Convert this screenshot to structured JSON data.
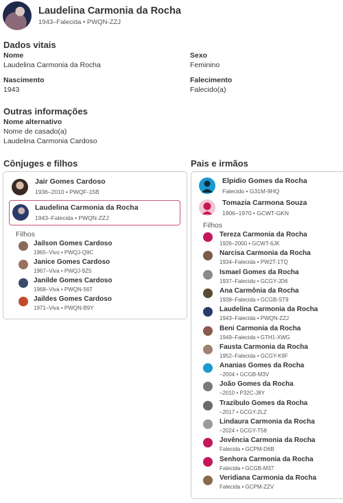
{
  "header": {
    "name": "Laudelina Carmonia da Rocha",
    "meta": "1943–Falecida • PWQN-ZZJ"
  },
  "vitals": {
    "title": "Dados vitais",
    "name_label": "Nome",
    "name_value": "Laudelina Carmonia da Rocha",
    "sex_label": "Sexo",
    "sex_value": "Feminino",
    "birth_label": "Nascimento",
    "birth_value": "1943",
    "death_label": "Falecimento",
    "death_value": "Falecido(a)"
  },
  "other": {
    "title": "Outras informações",
    "alt_label": "Nome alternativo",
    "married_label": "Nome de casado(a)",
    "married_value": "Laudelina Carmonia Cardoso"
  },
  "spouses": {
    "title": "Cônjuges e filhos",
    "spouse": {
      "name": "Jair Gomes Cardoso",
      "meta": "1936–2010 • PWQF-15B"
    },
    "self": {
      "name": "Laudelina Carmonia da Rocha",
      "meta": "1943–Falecida • PWQN-ZZJ"
    },
    "children_label": "Filhos",
    "children": [
      {
        "name": "Jailson Gomes Cardoso",
        "meta": "1965–Vivo • PWQJ-Q9C",
        "color": "#8a6a5a"
      },
      {
        "name": "Janice Gomes Cardoso",
        "meta": "1967–Viva • PWQJ-9Z5",
        "color": "#9a7060"
      },
      {
        "name": "Janilde Gomes Cardoso",
        "meta": "1968–Viva • PWQN-56T",
        "color": "#3a4a6a"
      },
      {
        "name": "Jaildes Gomes Cardoso",
        "meta": "1971–Viva • PWQN-B9Y",
        "color": "#c04a2a"
      }
    ]
  },
  "parents": {
    "title": "Pais e irmãos",
    "father": {
      "name": "Elpidio Gomes da Rocha",
      "meta": "Falecido • G31M-9HQ"
    },
    "mother": {
      "name": "Tomazia Carmona Souza",
      "meta": "1906–1970 • GCWT-GKN"
    },
    "children_label": "Filhos",
    "siblings": [
      {
        "name": "Tereza Carmonia da Rocha",
        "meta": "1926–2000 • GCWT-6JK",
        "color": "#c2185b"
      },
      {
        "name": "Narcisa Carmonia da Rocha",
        "meta": "1934–Falecida • PW2T-1TQ",
        "color": "#7a5a48"
      },
      {
        "name": "Ismael Gomes da Rocha",
        "meta": "1937–Falecido • GCGY-JD6",
        "color": "#8a8a8a"
      },
      {
        "name": "Ana Carmônia da Rocha",
        "meta": "1939–Falecida • GCGB-ST9",
        "color": "#5a4a30"
      },
      {
        "name": "Laudelina Carmonia da Rocha",
        "meta": "1943–Falecida • PWQN-ZZJ",
        "color": "#2a3a6a"
      },
      {
        "name": "Beni Carmonia da Rocha",
        "meta": "1949–Falecida • GTH1-XWG",
        "color": "#8a5a4a"
      },
      {
        "name": "Fausta Carmonia da Rocha",
        "meta": "1952–Falecida • GCGY-K9F",
        "color": "#a08070"
      },
      {
        "name": "Ananias Gomes da Rocha",
        "meta": "–2004 • GCGB-M3V",
        "color": "#1a9ad0"
      },
      {
        "name": "João Gomes da Rocha",
        "meta": "–2010 • P32C-J8Y",
        "color": "#7a7a7a"
      },
      {
        "name": "Trazibulo Gomes da Rocha",
        "meta": "–2017 • GCGY-2LZ",
        "color": "#6a6a6a"
      },
      {
        "name": "Lindaura Carmonia da Rocha",
        "meta": "–2024 • GCGY-T58",
        "color": "#9a9a9a"
      },
      {
        "name": "Jovência Carmonia da Rocha",
        "meta": "Falecida • GCPM-D6B",
        "color": "#c2185b"
      },
      {
        "name": "Senhora Carmonia da Rocha",
        "meta": "Falecida • GCGB-M37",
        "color": "#c2185b"
      },
      {
        "name": "Veridiana Carmonia da Rocha",
        "meta": "Falecida • GCPM-ZZV",
        "color": "#8a6a4a"
      }
    ]
  },
  "colors": {
    "selected_border": "#c9577a",
    "female_icon": "#c2185b",
    "male_icon": "#1a9ad0"
  }
}
